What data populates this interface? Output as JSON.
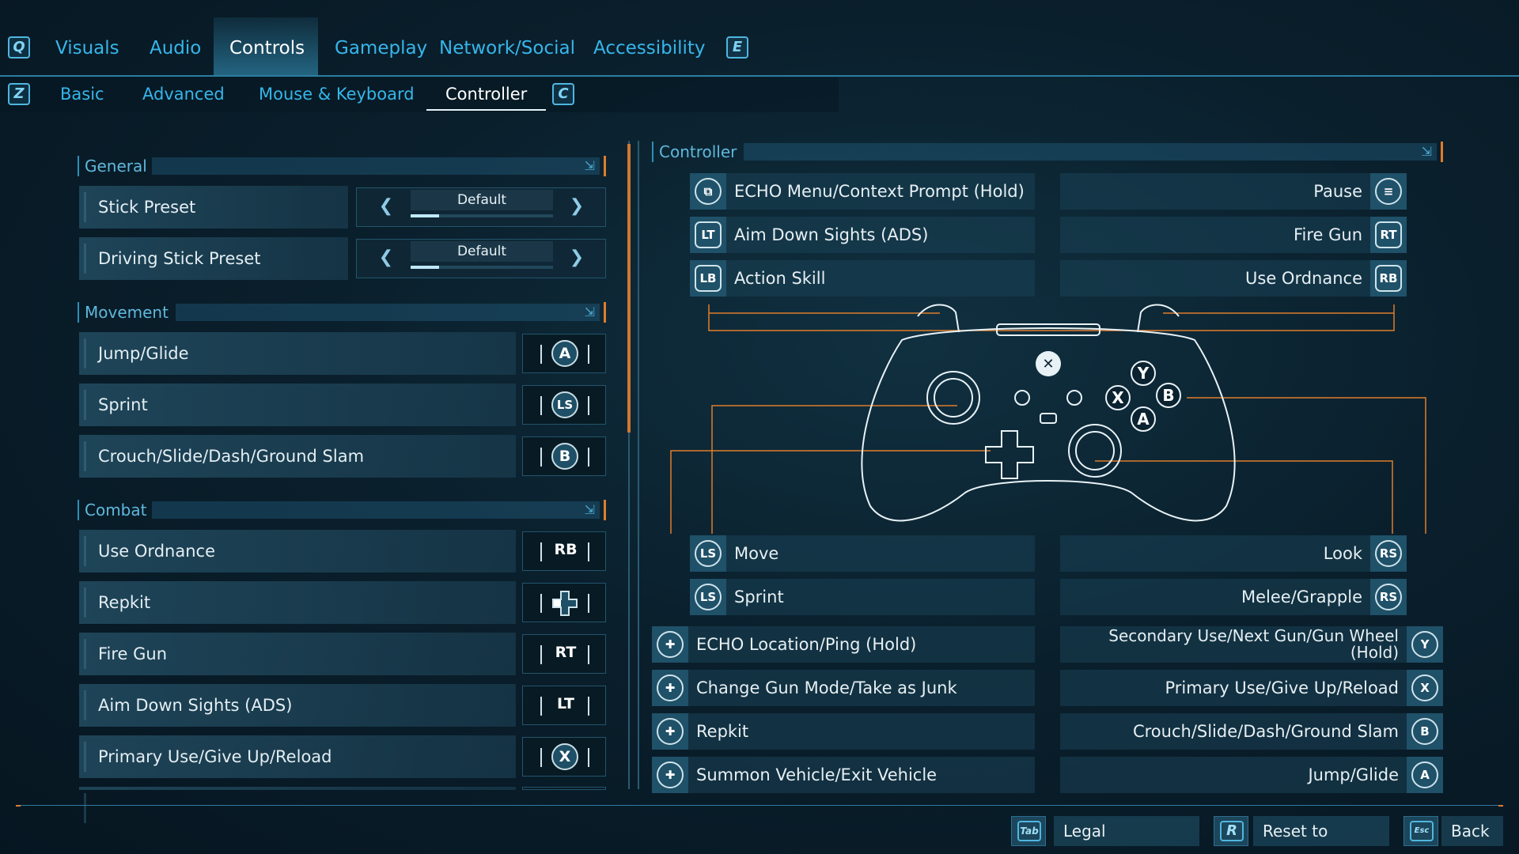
{
  "top_tabs": {
    "left_key": "Q",
    "right_key": "E",
    "items": [
      "Visuals",
      "Audio",
      "Controls",
      "Gameplay",
      "Network/Social",
      "Accessibility"
    ],
    "active": "Controls"
  },
  "sub_tabs": {
    "left_key": "Z",
    "right_key": "C",
    "items": [
      "Basic",
      "Advanced",
      "Mouse & Keyboard",
      "Controller"
    ],
    "active": "Controller"
  },
  "general": {
    "title": "General",
    "rows": [
      {
        "label": "Stick Preset",
        "value": "Default",
        "fill": 0.2
      },
      {
        "label": "Driving Stick Preset",
        "value": "Default",
        "fill": 0.2
      }
    ]
  },
  "movement": {
    "title": "Movement",
    "rows": [
      {
        "label": "Jump/Glide",
        "button": "A"
      },
      {
        "label": "Sprint",
        "button": "LS"
      },
      {
        "label": "Crouch/Slide/Dash/Ground Slam",
        "button": "B"
      }
    ]
  },
  "combat": {
    "title": "Combat",
    "rows": [
      {
        "label": "Use Ordnance",
        "button": "RB"
      },
      {
        "label": "Repkit",
        "button": "dpad-left"
      },
      {
        "label": "Fire Gun",
        "button": "RT"
      },
      {
        "label": "Aim Down Sights (ADS)",
        "button": "LT"
      },
      {
        "label": "Primary Use/Give Up/Reload",
        "button": "X"
      }
    ]
  },
  "controller_panel": {
    "title": "Controller",
    "top_left": [
      {
        "label": "ECHO Menu/Context Prompt (Hold)",
        "icon": "view-icon"
      },
      {
        "label": "Aim Down Sights (ADS)",
        "icon": "LT"
      },
      {
        "label": "Action Skill",
        "icon": "LB"
      }
    ],
    "top_right": [
      {
        "label": "Pause",
        "icon": "menu-icon"
      },
      {
        "label": "Fire Gun",
        "icon": "RT"
      },
      {
        "label": "Use Ordnance",
        "icon": "RB"
      }
    ],
    "stick_left": [
      {
        "label": "Move",
        "icon": "LS"
      },
      {
        "label": "Sprint",
        "icon": "LS"
      }
    ],
    "stick_right": [
      {
        "label": "Look",
        "icon": "RS"
      },
      {
        "label": "Melee/Grapple",
        "icon": "RS"
      }
    ],
    "bottom_left": [
      {
        "label": "ECHO Location/Ping (Hold)",
        "icon": "dpad-up-icon"
      },
      {
        "label": "Change Gun Mode/Take as Junk",
        "icon": "dpad-down-icon"
      },
      {
        "label": "Repkit",
        "icon": "dpad-left-icon"
      },
      {
        "label": "Summon Vehicle/Exit Vehicle",
        "icon": "dpad-right-icon"
      }
    ],
    "bottom_right": [
      {
        "label": "Secondary Use/Next Gun/Gun Wheel",
        "label2": "(Hold)",
        "icon": "Y"
      },
      {
        "label": "Primary Use/Give Up/Reload",
        "icon": "X"
      },
      {
        "label": "Crouch/Slide/Dash/Ground Slam",
        "icon": "B"
      },
      {
        "label": "Jump/Glide",
        "icon": "A"
      }
    ],
    "face_buttons": {
      "y": "Y",
      "x": "X",
      "b": "B",
      "a": "A"
    }
  },
  "footer": {
    "legal_key": "Tab",
    "legal_label": "Legal Information",
    "reset_key": "R",
    "reset_label": "Reset to Default",
    "back_key": "Esc",
    "back_label": "Back"
  },
  "colors": {
    "accent_orange": "#e07d2a",
    "accent_blue": "#36b6ea",
    "panel": "#1a4256"
  }
}
